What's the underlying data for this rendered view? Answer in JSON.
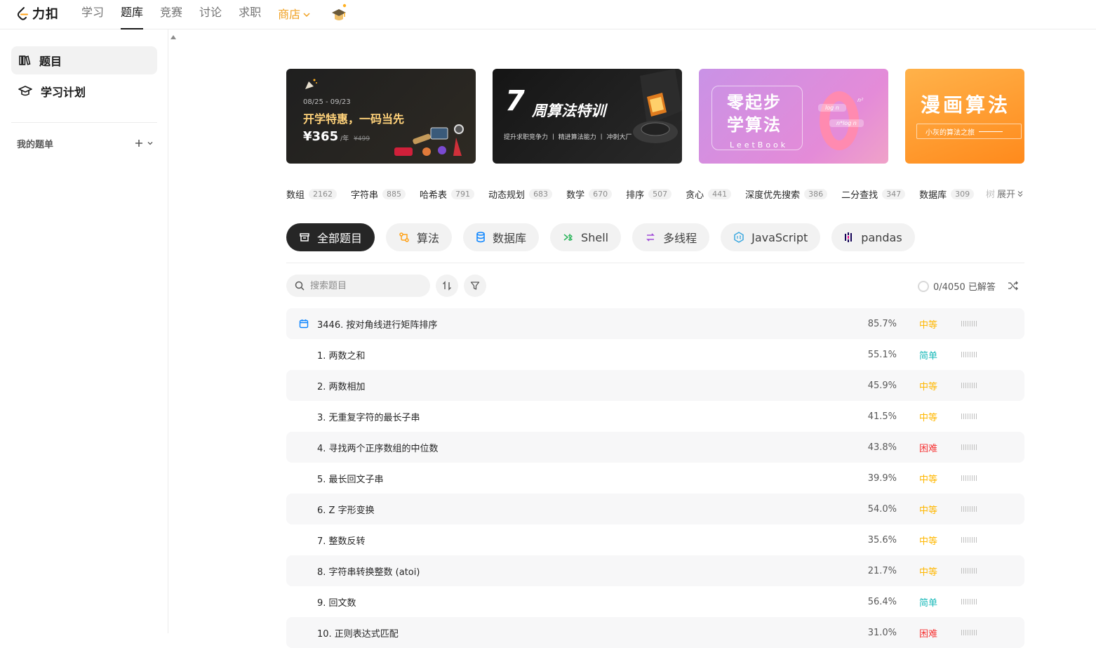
{
  "logo": {
    "text": "力扣"
  },
  "nav": {
    "links": [
      "学习",
      "题库",
      "竞赛",
      "讨论",
      "求职"
    ],
    "store": "商店"
  },
  "sidebar": {
    "items": [
      {
        "label": "题目",
        "icon": "library-icon"
      },
      {
        "label": "学习计划",
        "icon": "graduation-cap-icon"
      }
    ],
    "my_list_label": "我的题单"
  },
  "banners": {
    "b1": {
      "date": "08/25 - 09/23",
      "headline": "开学特惠，一码当先",
      "price": "¥365",
      "per": "/年",
      "old_price": "¥499"
    },
    "b2": {
      "number": "7",
      "title": "周算法特训",
      "subtitle": "提升求职竞争力 丨 精进算法能力 丨 冲刺大厂"
    },
    "b3": {
      "line1": "零起步",
      "line2": "学算法",
      "brand": "LeetBook",
      "tag1": "log n",
      "tag2": "n*log n",
      "tag3": "n²"
    },
    "b4": {
      "title": "漫画算法",
      "subtitle": "小灰的算法之旅"
    }
  },
  "tags": [
    {
      "name": "数组",
      "count": "2162"
    },
    {
      "name": "字符串",
      "count": "885"
    },
    {
      "name": "哈希表",
      "count": "791"
    },
    {
      "name": "动态规划",
      "count": "683"
    },
    {
      "name": "数学",
      "count": "670"
    },
    {
      "name": "排序",
      "count": "507"
    },
    {
      "name": "贪心",
      "count": "441"
    },
    {
      "name": "深度优先搜索",
      "count": "386"
    },
    {
      "name": "二分查找",
      "count": "347"
    },
    {
      "name": "数据库",
      "count": "309"
    }
  ],
  "tags_expand": "展开",
  "tags_cut_off": "树",
  "pills": [
    {
      "label": "全部题目",
      "icon": "archive-icon",
      "color": "#ffffff"
    },
    {
      "label": "算法",
      "icon": "algorithm-icon",
      "color": "#ffa116"
    },
    {
      "label": "数据库",
      "icon": "database-icon",
      "color": "#0a84ff"
    },
    {
      "label": "Shell",
      "icon": "shell-icon",
      "color": "#2db55d"
    },
    {
      "label": "多线程",
      "icon": "thread-icon",
      "color": "#a24cd8"
    },
    {
      "label": "JavaScript",
      "icon": "javascript-icon",
      "color": "#3aa8e0"
    },
    {
      "label": "pandas",
      "icon": "pandas-icon",
      "color": "#150458"
    }
  ],
  "search": {
    "placeholder": "搜索题目"
  },
  "progress_text": "0/4050 已解答",
  "problems": [
    {
      "title": "3446. 按对角线进行矩阵排序",
      "rate": "85.7%",
      "difficulty": "中等",
      "level": "med",
      "daily": true
    },
    {
      "title": "1. 两数之和",
      "rate": "55.1%",
      "difficulty": "简单",
      "level": "easy"
    },
    {
      "title": "2. 两数相加",
      "rate": "45.9%",
      "difficulty": "中等",
      "level": "med"
    },
    {
      "title": "3. 无重复字符的最长子串",
      "rate": "41.5%",
      "difficulty": "中等",
      "level": "med"
    },
    {
      "title": "4. 寻找两个正序数组的中位数",
      "rate": "43.8%",
      "difficulty": "困难",
      "level": "hard"
    },
    {
      "title": "5. 最长回文子串",
      "rate": "39.9%",
      "difficulty": "中等",
      "level": "med"
    },
    {
      "title": "6. Z 字形变换",
      "rate": "54.0%",
      "difficulty": "中等",
      "level": "med"
    },
    {
      "title": "7. 整数反转",
      "rate": "35.6%",
      "difficulty": "中等",
      "level": "med"
    },
    {
      "title": "8. 字符串转换整数 (atoi)",
      "rate": "21.7%",
      "difficulty": "中等",
      "level": "med"
    },
    {
      "title": "9. 回文数",
      "rate": "56.4%",
      "difficulty": "简单",
      "level": "easy"
    },
    {
      "title": "10. 正则表达式匹配",
      "rate": "31.0%",
      "difficulty": "困难",
      "level": "hard"
    }
  ]
}
